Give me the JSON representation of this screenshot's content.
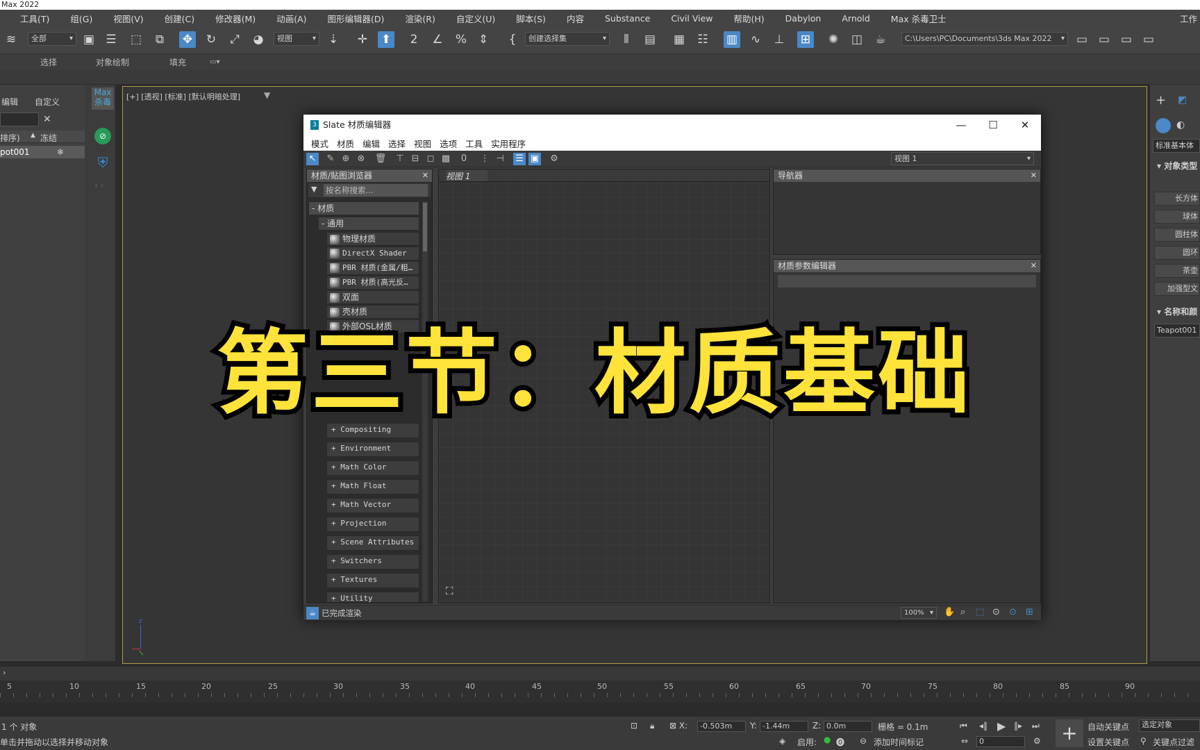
{
  "app": {
    "title": "Max 2022"
  },
  "menu": [
    "工具(T)",
    "组(G)",
    "视图(V)",
    "创建(C)",
    "修改器(M)",
    "动画(A)",
    "图形编辑器(D)",
    "渲染(R)",
    "自定义(U)",
    "脚本(S)",
    "内容",
    "Substance",
    "Civil View",
    "帮助(H)",
    "Dabylon",
    "Arnold",
    "Max 杀毒卫士"
  ],
  "menu_right": "工作",
  "toolbar": {
    "filter": "全部",
    "refsys": "视图",
    "selset": "创建选择集",
    "path": "C:\\Users\\PC\\Documents\\3ds Max 2022"
  },
  "ribbon": {
    "select": "选择",
    "objpaint": "对象绘制",
    "fill": "填充"
  },
  "left": {
    "edit": "编辑",
    "custom": "自定义",
    "col1": "排序)",
    "col2": "冻结",
    "row": "pot001",
    "max": "Max",
    "antivirus": "杀毒"
  },
  "viewport": {
    "label": "[+] [透视] [标准] [默认明暗处理]"
  },
  "slate": {
    "title": "Slate 材质编辑器",
    "logo": "3",
    "menu": [
      "模式",
      "材质",
      "编辑",
      "选择",
      "视图",
      "选项",
      "工具",
      "实用程序"
    ],
    "view_select": "视图 1",
    "browser": {
      "title": "材质/贴图浏览器",
      "search": "按名称搜索...",
      "materials": "- 材质",
      "general": "- 通用",
      "items": [
        "物理材质",
        "DirectX Shader",
        "PBR 材质(金属/粗…",
        "PBR 材质(高光反…",
        "双面",
        "壳材质",
        "外部OSL材质"
      ],
      "maps": [
        "Compositing",
        "Environment",
        "Math Color",
        "Math Float",
        "Math Vector",
        "Projection",
        "Scene Attributes",
        "Switchers",
        "Textures",
        "Utility"
      ]
    },
    "view_tab": "视图 1",
    "navigator": "导航器",
    "params": "材质参数编辑器",
    "status": "已完成渲染",
    "zoom": "100%"
  },
  "overlay": "第三节：材质基础",
  "timeline": [
    "5",
    "10",
    "15",
    "20",
    "25",
    "30",
    "35",
    "40",
    "45",
    "50",
    "55",
    "60",
    "65",
    "70",
    "75",
    "80",
    "85",
    "90"
  ],
  "status": {
    "objects": "1 个 对象",
    "hint": "单击并拖动以选择并移动对象",
    "x": "-0.503m",
    "y": "-1.44m",
    "z": "0.0m",
    "grid": "栅格 = 0.1m",
    "enable": "启用:",
    "addtime": "添加时间标记",
    "autokey": "自动关键点",
    "selobj": "选定对象",
    "setkey": "设置关键点",
    "keyfilter": "关键点过滤",
    "frame": "0"
  },
  "cmd": {
    "std": "标准基本体",
    "objtype": "对象类型",
    "btns": [
      "长方体",
      "球体",
      "圆柱体",
      "圆环",
      "茶壶",
      "加强型文"
    ],
    "namecolor": "名称和颜",
    "name": "Teapot001"
  }
}
